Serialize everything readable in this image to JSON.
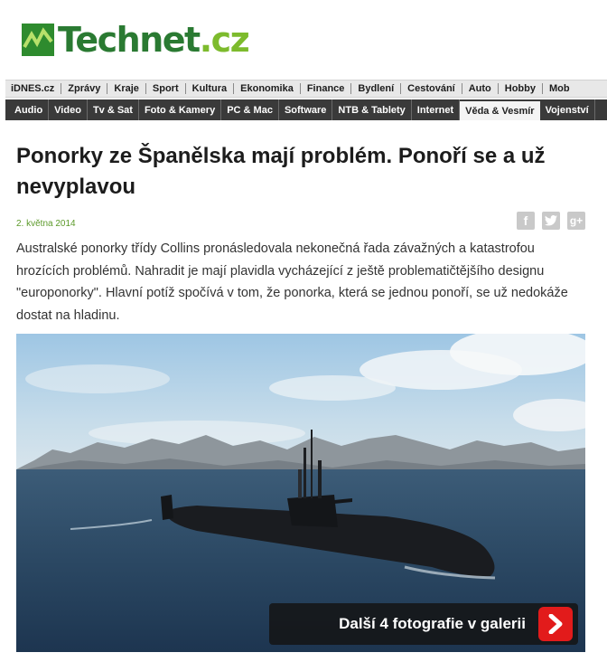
{
  "logo": {
    "part1": "Technet",
    "part2": ".cz"
  },
  "nav_primary": [
    "iDNES.cz",
    "Zprávy",
    "Kraje",
    "Sport",
    "Kultura",
    "Ekonomika",
    "Finance",
    "Bydlení",
    "Cestování",
    "Auto",
    "Hobby",
    "Mob"
  ],
  "nav_secondary": [
    "Audio",
    "Video",
    "Tv & Sat",
    "Foto & Kamery",
    "PC & Mac",
    "Software",
    "NTB & Tablety",
    "Internet",
    "Věda & Vesmír",
    "Vojenství"
  ],
  "nav_secondary_active": "Věda & Vesmír",
  "article": {
    "title": "Ponorky ze Španělska mají problém. Ponoří se a už nevyplavou",
    "date": "2. května 2014",
    "perex": "Australské ponorky třídy Collins pronásledovala nekonečná řada závažných a katastrofou hrozících problémů. Nahradit je mají plavidla vycházející z ještě problematičtějšího designu \"europonorky\". Hlavní potíž spočívá v tom, že ponorka, která se jednou ponoří, se už nedokáže dostat na hladinu."
  },
  "share_icons": [
    "facebook-icon",
    "twitter-icon",
    "google-plus-icon"
  ],
  "gallery": {
    "label": "Další 4 fotografie v galerii"
  },
  "colors": {
    "brand_dark": "#2a7a32",
    "brand_light": "#7dbb2d",
    "gallery_arrow": "#e21b1b",
    "date": "#5c9a2a"
  }
}
